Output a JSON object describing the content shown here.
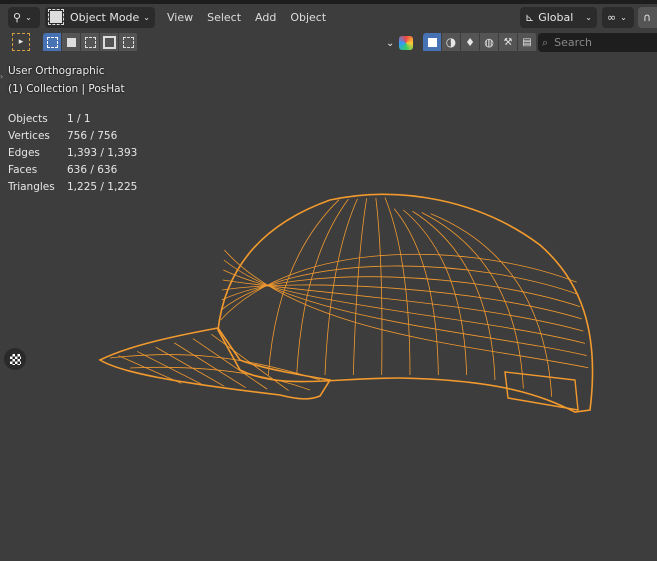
{
  "header": {
    "mode_label": "Object Mode",
    "menus": [
      "View",
      "Select",
      "Add",
      "Object"
    ],
    "orientation_label": "Global",
    "search_placeholder": "Search"
  },
  "overlay": {
    "view_name": "User Orthographic",
    "collection_line": "(1) Collection | PosHat"
  },
  "stats": [
    {
      "label": "Objects",
      "value": "1 / 1"
    },
    {
      "label": "Vertices",
      "value": "756 / 756"
    },
    {
      "label": "Edges",
      "value": "1,393 / 1,393"
    },
    {
      "label": "Faces",
      "value": "636 / 636"
    },
    {
      "label": "Triangles",
      "value": "1,225 / 1,225"
    }
  ],
  "colors": {
    "wire": "#f29a2e",
    "bg": "#3d3d3d",
    "active": "#4772b3"
  }
}
